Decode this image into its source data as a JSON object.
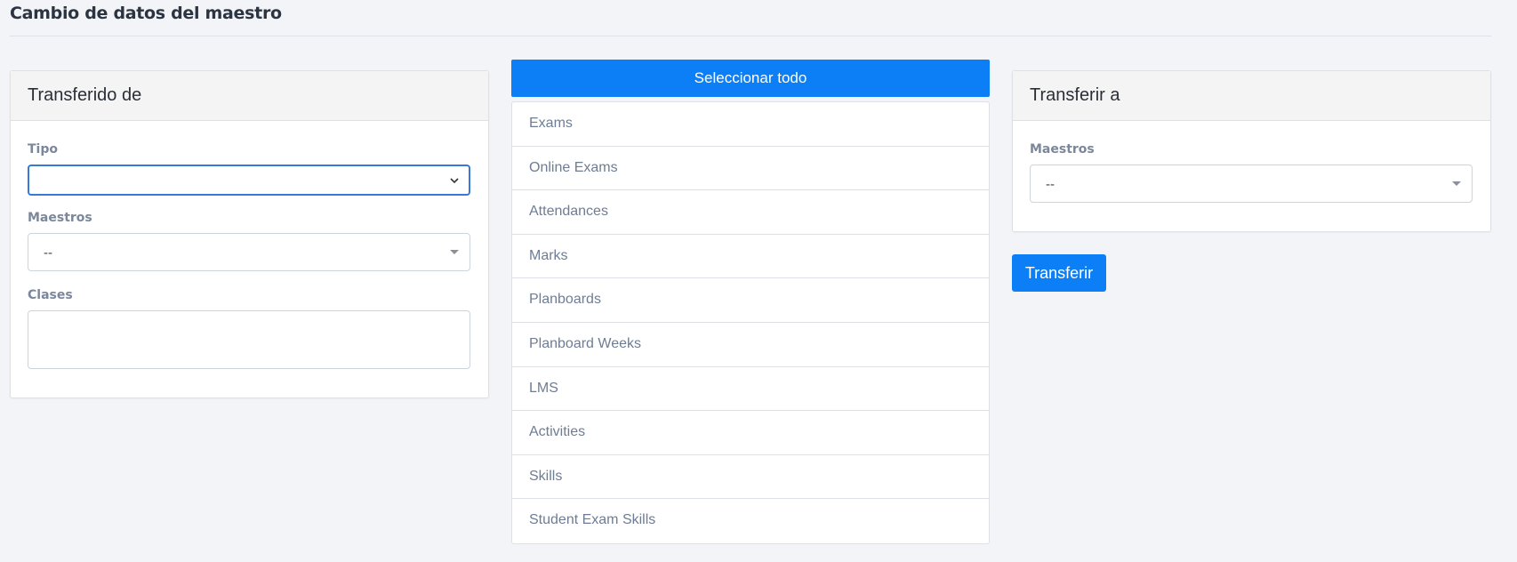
{
  "page": {
    "title": "Cambio de datos del maestro"
  },
  "from_panel": {
    "header": "Transferido de",
    "tipo_label": "Tipo",
    "tipo_value": "",
    "maestros_label": "Maestros",
    "maestros_value": "--",
    "clases_label": "Clases",
    "clases_value": ""
  },
  "middle": {
    "select_all_label": "Seleccionar todo",
    "items": [
      "Exams",
      "Online Exams",
      "Attendances",
      "Marks",
      "Planboards",
      "Planboard Weeks",
      "LMS",
      "Activities",
      "Skills",
      "Student Exam Skills"
    ]
  },
  "to_panel": {
    "header": "Transferir a",
    "maestros_label": "Maestros",
    "maestros_value": "--",
    "transfer_label": "Transferir"
  },
  "colors": {
    "accent": "#0d7ff6",
    "background": "#f3f4f7",
    "focus_border": "#3a78d8",
    "label": "#7b879a",
    "list_text": "#6e7d94"
  },
  "icons": {
    "tipo_select": "chevron-down-icon",
    "maestros_select": "caret-down-icon"
  }
}
